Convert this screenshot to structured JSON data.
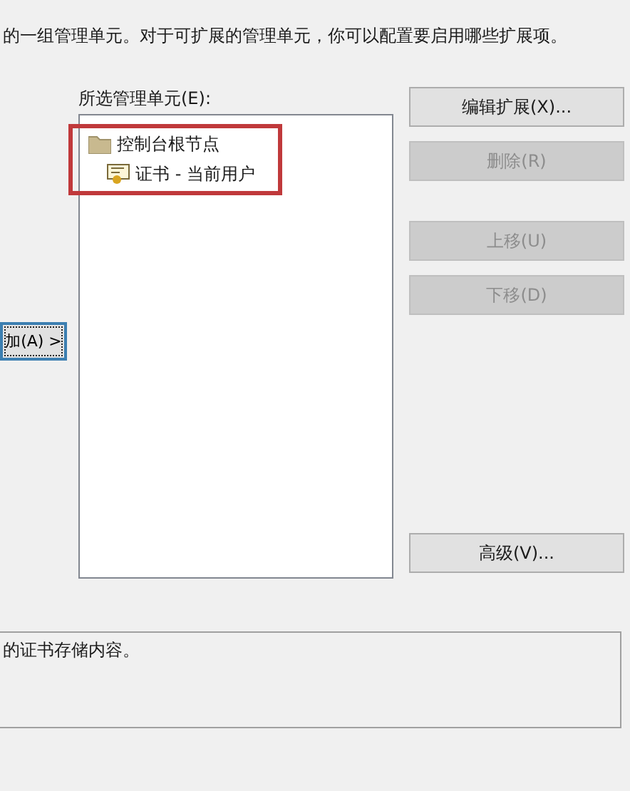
{
  "description": "的一组管理单元。对于可扩展的管理单元，你可以配置要启用哪些扩展项。",
  "add_button": {
    "label": "加(A) >",
    "focused": true
  },
  "selected_snapins": {
    "label": "所选管理单元(E):",
    "tree": [
      {
        "label": "控制台根节点",
        "kind": "folder",
        "children": [
          {
            "label": "证书 - 当前用户",
            "kind": "certificate"
          }
        ]
      }
    ],
    "annotation": {
      "kind": "highlight-box",
      "color": "#c0393b"
    }
  },
  "button_groups": [
    [
      {
        "label": "编辑扩展(X)...",
        "disabled": false
      },
      {
        "label": "删除(R)",
        "disabled": true
      }
    ],
    [
      {
        "label": "上移(U)",
        "disabled": true
      },
      {
        "label": "下移(D)",
        "disabled": true
      }
    ],
    [
      {
        "label": "高级(V)...",
        "disabled": false
      }
    ]
  ],
  "details": "的证书存储内容。"
}
